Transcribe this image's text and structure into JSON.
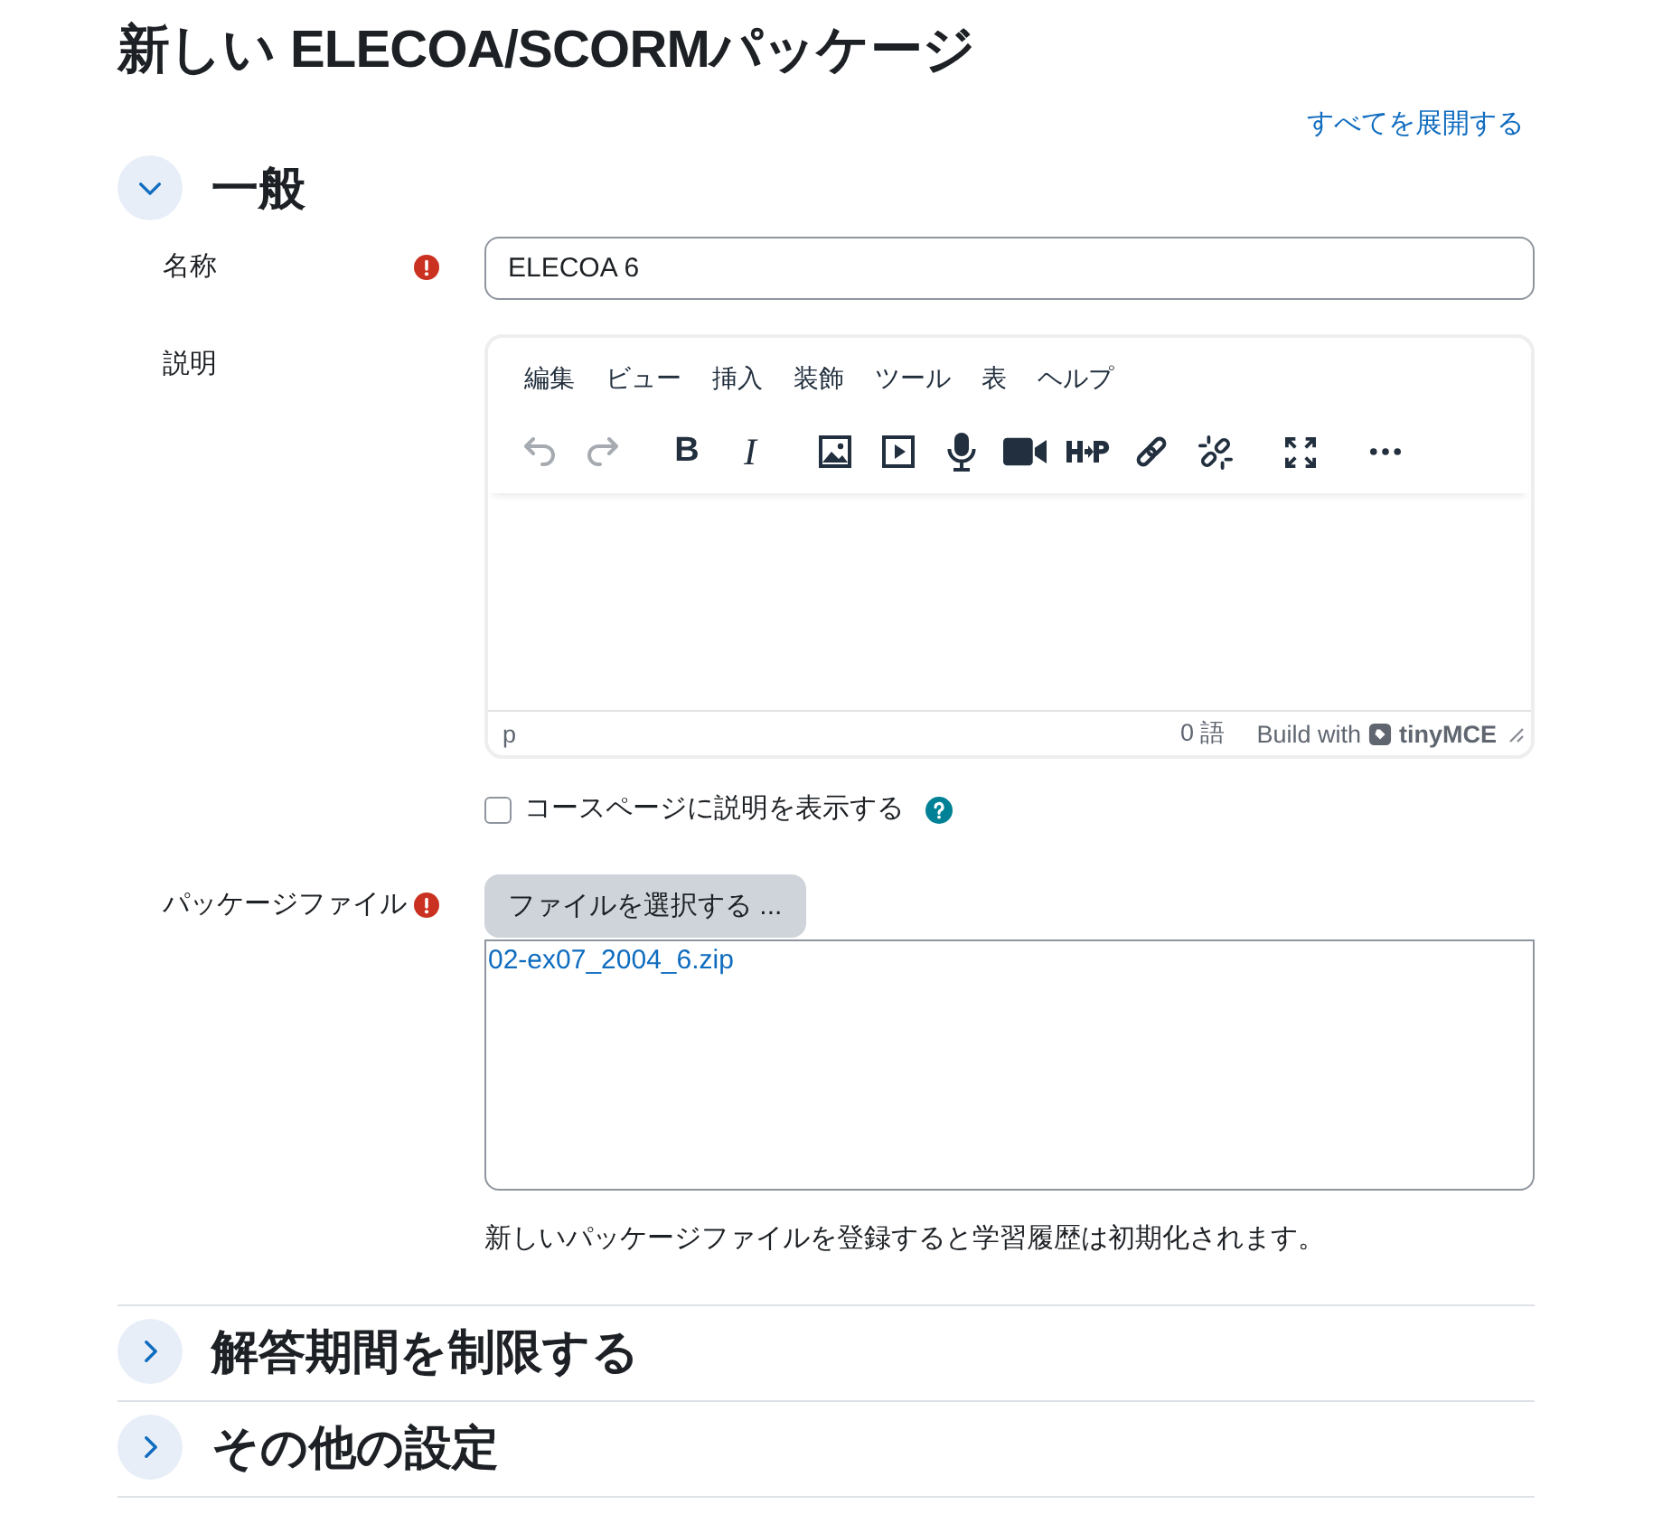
{
  "page": {
    "title": "新しい ELECOA/SCORMパッケージ",
    "expand_all": "すべてを展開する"
  },
  "sections": [
    {
      "title": "一般",
      "expanded": true,
      "fields": [
        {
          "kind": "text",
          "label": "名称",
          "required": true,
          "value": "ELECOA 6"
        },
        {
          "kind": "editor",
          "label": "説明",
          "required": false,
          "menu": [
            "編集",
            "ビュー",
            "挿入",
            "装飾",
            "ツール",
            "表",
            "ヘルプ"
          ],
          "toolbar": [
            {
              "buttons": [
                {
                  "kind": "undo",
                  "disabled": true
                },
                {
                  "kind": "redo",
                  "disabled": true
                }
              ]
            },
            {
              "buttons": [
                {
                  "kind": "bold",
                  "label": "B",
                  "disabled": false
                },
                {
                  "kind": "italic",
                  "label": "I",
                  "disabled": false
                }
              ]
            },
            {
              "buttons": [
                {
                  "kind": "image",
                  "disabled": false
                },
                {
                  "kind": "media",
                  "disabled": false
                },
                {
                  "kind": "microphone",
                  "disabled": false
                },
                {
                  "kind": "camera",
                  "disabled": false
                },
                {
                  "kind": "h5p",
                  "disabled": false
                },
                {
                  "kind": "link",
                  "disabled": false
                },
                {
                  "kind": "unlink",
                  "disabled": false
                }
              ]
            },
            {
              "buttons": [
                {
                  "kind": "fullscreen",
                  "disabled": false
                }
              ]
            },
            {
              "buttons": [
                {
                  "kind": "more",
                  "disabled": false
                }
              ]
            }
          ],
          "path": "p",
          "word_count": "0 語",
          "branding": "Build with",
          "brand_name": "tinyMCE"
        },
        {
          "kind": "checkbox",
          "label": "コースページに説明を表示する",
          "required": false,
          "checked": false,
          "help": true
        },
        {
          "kind": "filepicker",
          "label": "パッケージファイル",
          "required": true,
          "button": "ファイルを選択する ...",
          "files": [
            "02-ex07_2004_6.zip"
          ],
          "note": "新しいパッケージファイルを登録すると学習履歴は初期化されます。"
        }
      ]
    },
    {
      "title": "解答期間を制限する",
      "expanded": false
    },
    {
      "title": "その他の設定",
      "expanded": false
    }
  ]
}
